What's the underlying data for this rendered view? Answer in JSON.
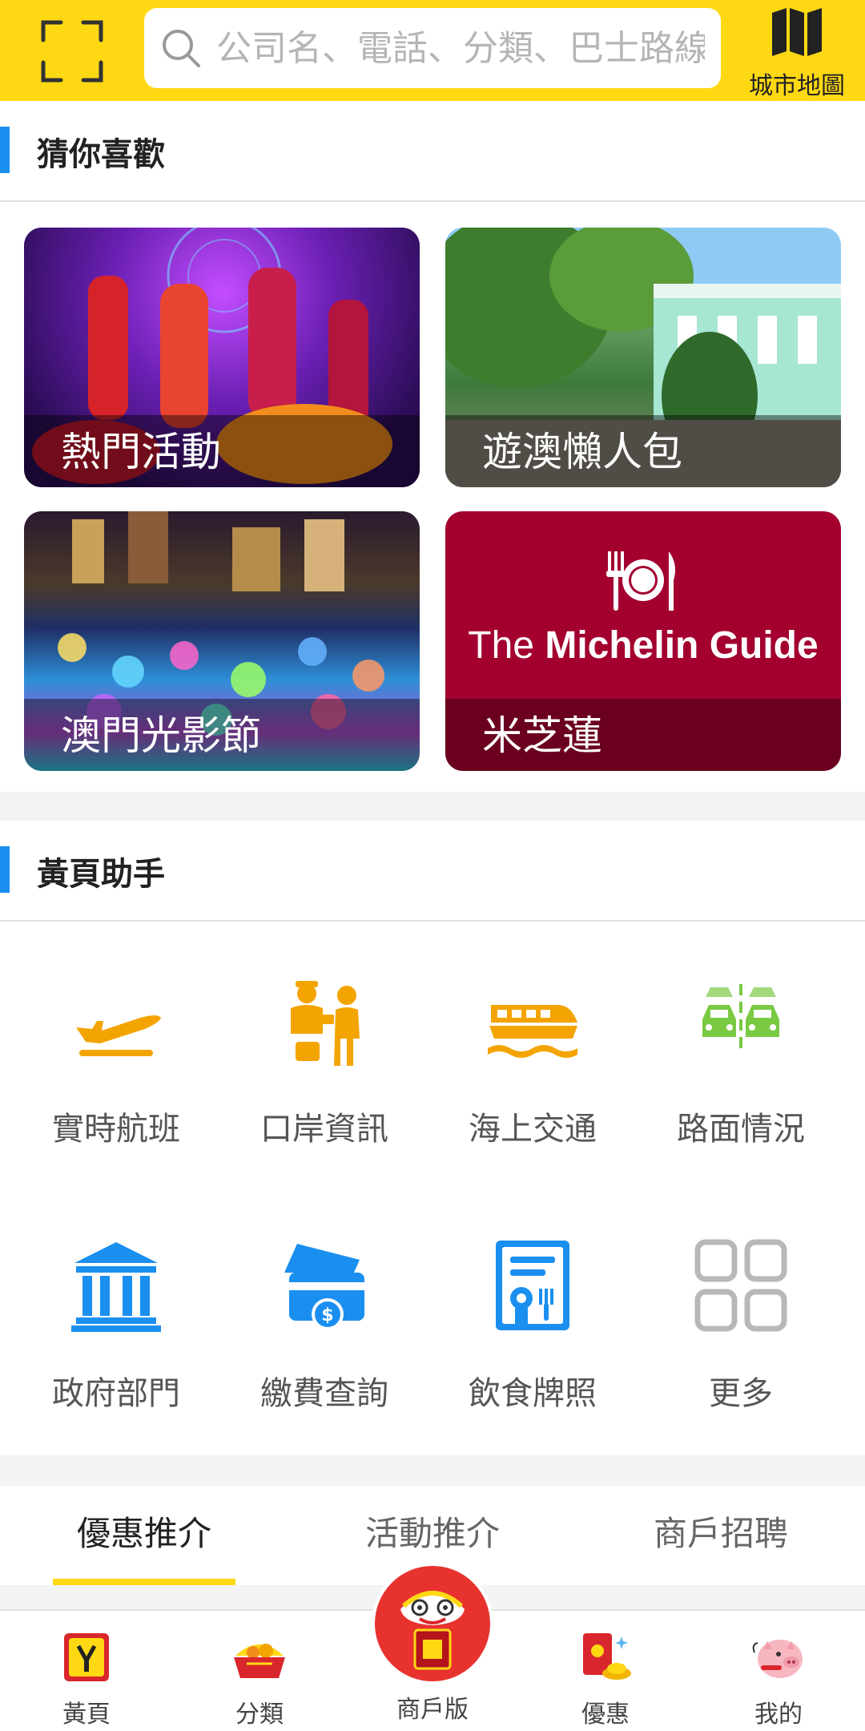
{
  "header": {
    "search_placeholder": "公司名、電話、分類、巴士路線",
    "map_label": "城市地圖"
  },
  "recommend": {
    "title": "猜你喜歡",
    "cards": [
      {
        "caption": "熱門活動"
      },
      {
        "caption": "遊澳懶人包"
      },
      {
        "caption": "澳門光影節"
      },
      {
        "caption": "米芝蓮",
        "brand_prefix": "The ",
        "brand_bold": "Michelin Guide"
      }
    ]
  },
  "helper": {
    "title": "黃頁助手",
    "items": [
      {
        "label": "實時航班",
        "icon": "airplane-icon"
      },
      {
        "label": "口岸資訊",
        "icon": "border-officer-icon"
      },
      {
        "label": "海上交通",
        "icon": "ferry-icon"
      },
      {
        "label": "路面情況",
        "icon": "traffic-cars-icon"
      },
      {
        "label": "政府部門",
        "icon": "government-building-icon"
      },
      {
        "label": "繳費查詢",
        "icon": "payment-card-icon"
      },
      {
        "label": "飲食牌照",
        "icon": "food-license-icon"
      },
      {
        "label": "更多",
        "icon": "grid-more-icon"
      }
    ]
  },
  "tabs": [
    {
      "label": "優惠推介",
      "active": true
    },
    {
      "label": "活動推介",
      "active": false
    },
    {
      "label": "商戶招聘",
      "active": false
    }
  ],
  "bottom_nav": [
    {
      "label": "黃頁",
      "icon": "yellow-pages-icon"
    },
    {
      "label": "分類",
      "icon": "category-basket-icon"
    },
    {
      "label": "商戶版",
      "icon": "lion-dance-icon"
    },
    {
      "label": "優惠",
      "icon": "red-packet-icon"
    },
    {
      "label": "我的",
      "icon": "pig-icon"
    }
  ],
  "colors": {
    "brand_yellow": "#ffd814",
    "accent_blue": "#1a8ff0",
    "icon_orange": "#f4a400",
    "icon_green": "#7ac943",
    "icon_blue": "#1a8ff0",
    "icon_gray": "#b8b8b8"
  }
}
